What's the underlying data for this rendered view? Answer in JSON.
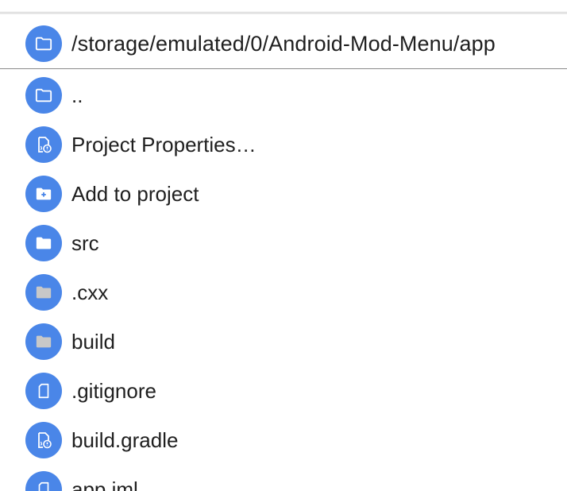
{
  "header": {
    "path": "/storage/emulated/0/Android-Mod-Menu/app",
    "icon": "folder-outline-icon"
  },
  "items": [
    {
      "label": "..",
      "icon": "folder-outline-icon"
    },
    {
      "label": "Project Properties…",
      "icon": "file-settings-icon"
    },
    {
      "label": "Add to project",
      "icon": "folder-plus-icon"
    },
    {
      "label": "src",
      "icon": "folder-white-icon"
    },
    {
      "label": ".cxx",
      "icon": "folder-gray-icon"
    },
    {
      "label": "build",
      "icon": "folder-gray-icon"
    },
    {
      "label": ".gitignore",
      "icon": "file-outline-icon"
    },
    {
      "label": "build.gradle",
      "icon": "file-settings-icon"
    },
    {
      "label": "app.iml",
      "icon": "file-outline-icon"
    }
  ],
  "colors": {
    "accent": "#4a86e8",
    "text": "#1f1f1f",
    "folder_gray": "#c8c8c8",
    "divider": "#8a8a8a"
  }
}
